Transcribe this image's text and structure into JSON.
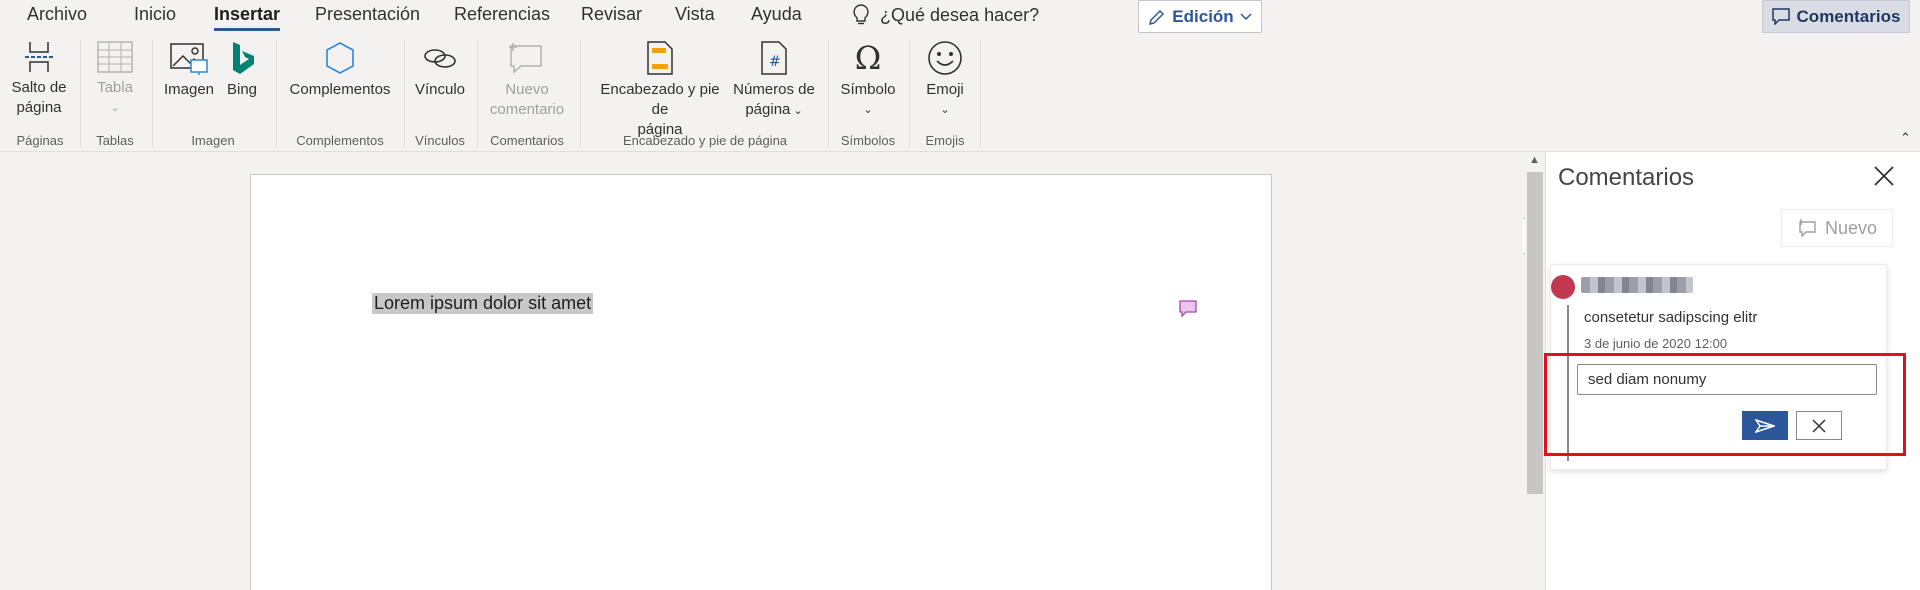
{
  "menu": {
    "tabs": [
      "Archivo",
      "Inicio",
      "Insertar",
      "Presentación",
      "Referencias",
      "Revisar",
      "Vista",
      "Ayuda"
    ],
    "tell_me": "¿Qué desea hacer?",
    "edit_mode": "Edición",
    "comments": "Comentarios"
  },
  "ribbon": {
    "page_break": [
      "Salto de",
      "página"
    ],
    "table": "Tabla",
    "image": "Imagen",
    "bing": "Bing",
    "addins": "Complementos",
    "link": "Vínculo",
    "new_comment": [
      "Nuevo",
      "comentario"
    ],
    "header_footer": [
      "Encabezado y pie de",
      "página"
    ],
    "page_numbers": [
      "Números de",
      "página"
    ],
    "symbol": "Símbolo",
    "emoji": "Emoji",
    "groups": [
      "Páginas",
      "Tablas",
      "Imagen",
      "Complementos",
      "Vínculos",
      "Comentarios",
      "Encabezado y pie de página",
      "Símbolos",
      "Emojis"
    ]
  },
  "document": {
    "text": "Lorem ipsum dolor sit amet"
  },
  "comments_pane": {
    "title": "Comentarios",
    "new_label": "Nuevo",
    "comment": {
      "text": "consetetur sadipscing elitr",
      "date": "3 de junio de 2020 12:00",
      "reply_value": "sed diam nonumy"
    }
  },
  "colors": {
    "accent": "#2b579a",
    "highlight": "#e1101d"
  }
}
